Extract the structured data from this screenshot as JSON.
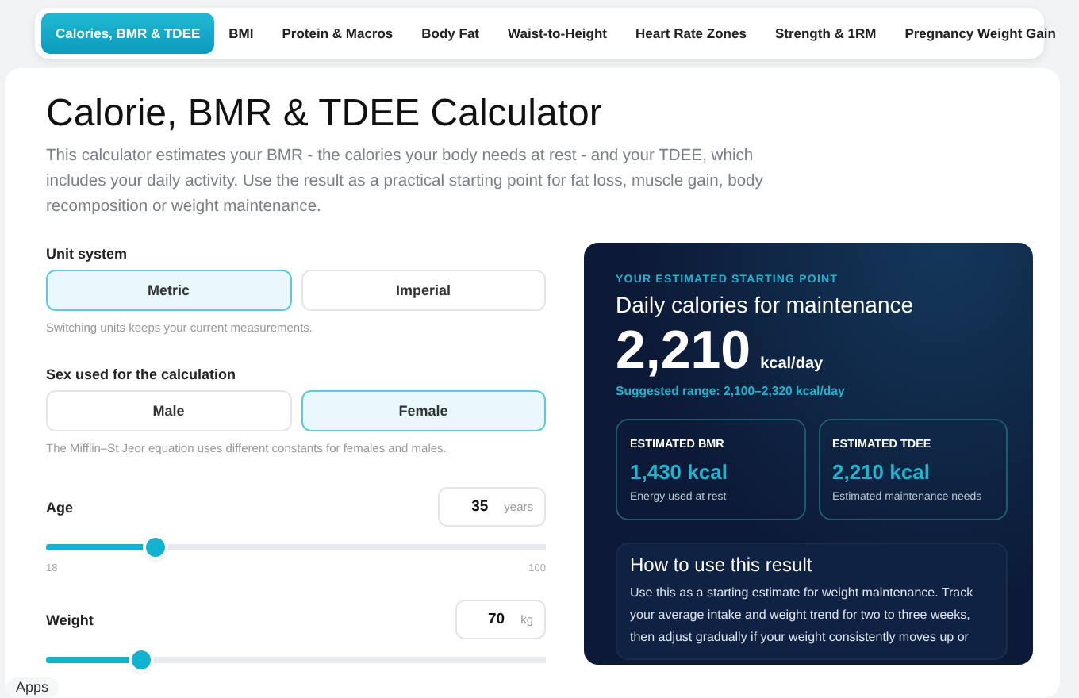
{
  "tabs": [
    {
      "label": "Calories, BMR & TDEE",
      "selected": true
    },
    {
      "label": "BMI",
      "selected": false
    },
    {
      "label": "Protein & Macros",
      "selected": false
    },
    {
      "label": "Body Fat",
      "selected": false
    },
    {
      "label": "Waist-to-Height",
      "selected": false
    },
    {
      "label": "Heart Rate Zones",
      "selected": false
    },
    {
      "label": "Strength & 1RM",
      "selected": false
    },
    {
      "label": "Pregnancy Weight Gain",
      "selected": false
    }
  ],
  "title": "Calorie, BMR & TDEE Calculator",
  "intro": "This calculator estimates your BMR - the calories your body needs at rest - and your TDEE, which includes your daily activity. Use the result as a practical starting point for fat loss, muscle gain, body recomposition or weight maintenance.",
  "choices": [
    {
      "label": "Unit system",
      "options": [
        {
          "label": "Metric",
          "selected": true
        },
        {
          "label": "Imperial",
          "selected": false
        }
      ],
      "hint": "Switching units keeps your current measurements."
    },
    {
      "label": "Sex used for the calculation",
      "options": [
        {
          "label": "Male",
          "selected": false
        },
        {
          "label": "Female",
          "selected": true
        }
      ],
      "hint": "The Mifflin–St Jeor equation uses different constants for females and males."
    }
  ],
  "sliders": [
    {
      "label": "Age",
      "value": "35",
      "unit": "years",
      "level": 0.22,
      "min": "18",
      "max": "100"
    },
    {
      "label": "Weight",
      "value": "70",
      "unit": "kg",
      "level": 0.19
    }
  ],
  "result": {
    "eyebrow": "YOUR ESTIMATED STARTING POINT",
    "heading": "Daily calories for maintenance",
    "value": "2,210",
    "unit": "kcal/day",
    "range": "Suggested range: 2,100–2,320 kcal/day",
    "stats": [
      {
        "label": "ESTIMATED BMR",
        "value": "1,430 kcal",
        "note": "Energy used at rest"
      },
      {
        "label": "ESTIMATED TDEE",
        "value": "2,210 kcal",
        "note": "Estimated maintenance needs"
      }
    ],
    "howto": {
      "title": "How to use this result",
      "text": "Use this as a starting estimate for weight maintenance. Track your average intake and weight trend for two to three weeks, then adjust gradually if your weight consistently moves up or"
    }
  },
  "apps_button": "Apps"
}
